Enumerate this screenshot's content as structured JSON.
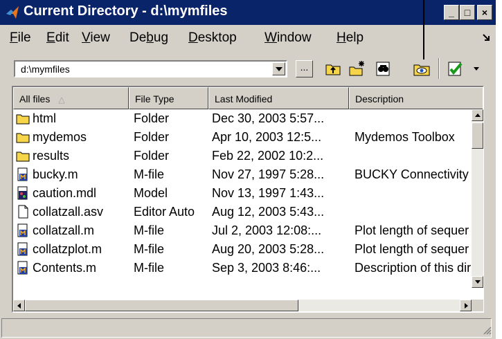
{
  "window": {
    "title": "Current Directory - d:\\mymfiles",
    "controls": {
      "minimize": "_",
      "maximize": "□",
      "close": "×"
    }
  },
  "menu": [
    {
      "label": "File",
      "mnemonic": "F",
      "rest": "ile"
    },
    {
      "label": "Edit",
      "mnemonic": "E",
      "rest": "dit"
    },
    {
      "label": "View",
      "mnemonic": "V",
      "rest": "iew"
    },
    {
      "label": "Debug",
      "before": "De",
      "mnemonic": "b",
      "rest": "ug"
    },
    {
      "label": "Desktop",
      "mnemonic": "D",
      "rest": "esktop"
    },
    {
      "label": "Window",
      "mnemonic": "W",
      "rest": "indow"
    },
    {
      "label": "Help",
      "mnemonic": "H",
      "rest": "elp"
    }
  ],
  "toolbar": {
    "path_value": "d:\\mymfiles",
    "browse_label": "...",
    "icons": [
      "up-folder-icon",
      "new-folder-icon",
      "find-icon",
      "visual-directory-icon",
      "reports-icon"
    ]
  },
  "columns": [
    "All files",
    "File Type",
    "Last Modified",
    "Description"
  ],
  "sort_indicator": "△",
  "rows": [
    {
      "name": "html",
      "type": "Folder",
      "modified": "Dec 30, 2003 5:57...",
      "description": "",
      "icon": "folder-icon"
    },
    {
      "name": "mydemos",
      "type": "Folder",
      "modified": "Apr 10, 2003 12:5...",
      "description": "Mydemos Toolbox",
      "icon": "folder-icon"
    },
    {
      "name": "results",
      "type": "Folder",
      "modified": "Feb 22, 2002 10:2...",
      "description": "",
      "icon": "folder-icon"
    },
    {
      "name": "bucky.m",
      "type": "M-file",
      "modified": "Nov 27, 1997 5:28...",
      "description": "BUCKY  Connectivity",
      "icon": "m-file-icon"
    },
    {
      "name": "caution.mdl",
      "type": "Model",
      "modified": "Nov 13, 1997 1:43...",
      "description": "",
      "icon": "model-file-icon"
    },
    {
      "name": "collatzall.asv",
      "type": "Editor Auto",
      "modified": "Aug 12, 2003 5:43...",
      "description": "",
      "icon": "blank-file-icon"
    },
    {
      "name": "collatzall.m",
      "type": "M-file",
      "modified": "Jul 2, 2003 12:08:...",
      "description": "Plot length of sequer",
      "icon": "m-file-icon"
    },
    {
      "name": "collatzplot.m",
      "type": "M-file",
      "modified": "Aug 20, 2003 5:28...",
      "description": "Plot length of sequer",
      "icon": "m-file-icon"
    },
    {
      "name": "Contents.m",
      "type": "M-file",
      "modified": "Sep 3, 2003 8:46:...",
      "description": "Description of this dir",
      "icon": "m-file-icon"
    }
  ],
  "colors": {
    "titlebar": "#0a246a",
    "chrome": "#d4d0c8",
    "folder": "#f6d54a"
  }
}
